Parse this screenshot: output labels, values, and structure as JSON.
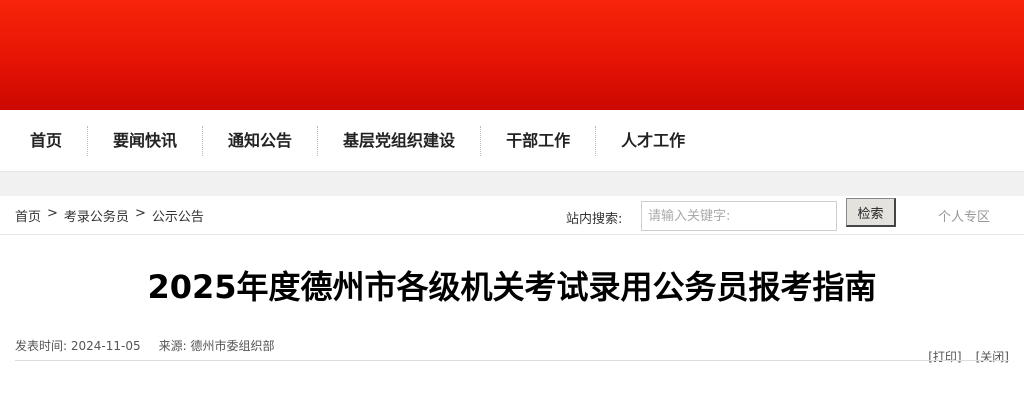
{
  "nav": {
    "items": [
      {
        "label": "首页"
      },
      {
        "label": "要闻快讯"
      },
      {
        "label": "通知公告"
      },
      {
        "label": "基层党组织建设"
      },
      {
        "label": "干部工作"
      },
      {
        "label": "人才工作"
      }
    ]
  },
  "breadcrumb": {
    "items": [
      "首页",
      "考录公务员",
      "公示公告"
    ],
    "separator": ">"
  },
  "search": {
    "label": "站内搜索:",
    "placeholder": "请输入关键字:",
    "button_label": "检索"
  },
  "personal_link": "个人专区",
  "article": {
    "title": "2025年度德州市各级机关考试录用公务员报考指南",
    "publish_label": "发表时间:",
    "publish_date": "2024-11-05",
    "source_label": "来源:",
    "source_value": "德州市委组织部",
    "print_label": "[打印]",
    "close_label": "[关闭]"
  },
  "colors": {
    "banner_top": "#f8250a",
    "banner_bottom": "#cc0800"
  }
}
